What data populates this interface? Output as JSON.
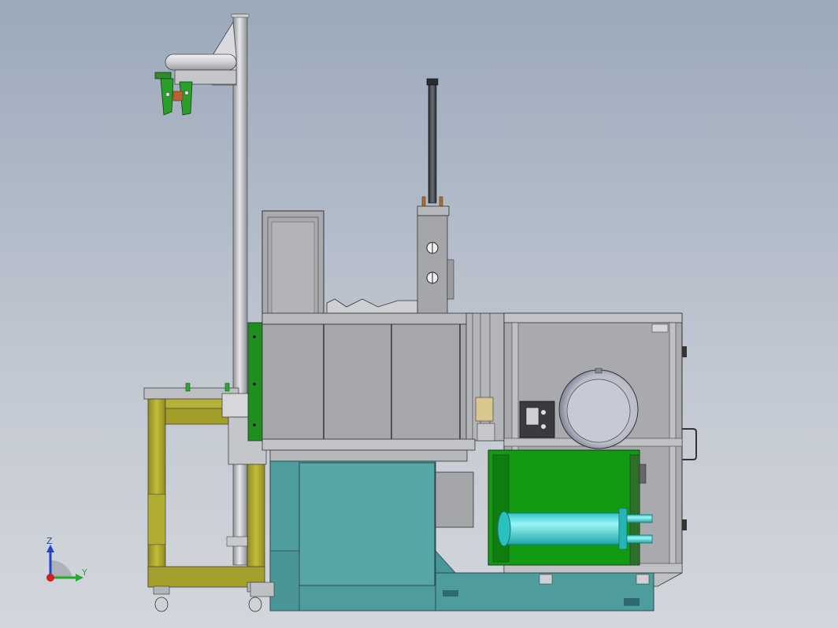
{
  "view": {
    "background_top": "#9ba9bb",
    "background_bottom": "#d3d6dc"
  },
  "triad": {
    "z_label": "Z",
    "y_label": "Y",
    "z_color": "#2244cc",
    "y_color": "#22aa33",
    "x_color": "#cc2222"
  },
  "palette": {
    "frame_gray": "#a7a9ac",
    "panel_gray": "#a3a4a6",
    "dark_outline": "#3a3a3a",
    "green_panel": "#149a14",
    "teal_base": "#4f9e9e",
    "cyan_cylinder": "#37d6d6",
    "yellow_frame": "#a7a32a",
    "silver_tank": "#c9ccd6",
    "pipe_gray": "#c8cacd"
  },
  "components": [
    "vertical-pole",
    "arm-bracket",
    "gripper",
    "lift-column",
    "upper-cabinet",
    "right-cabinet",
    "pressure-tank",
    "green-tank-enclosure",
    "cyan-cylinder",
    "teal-base",
    "yellow-cart",
    "caster-wheels"
  ]
}
